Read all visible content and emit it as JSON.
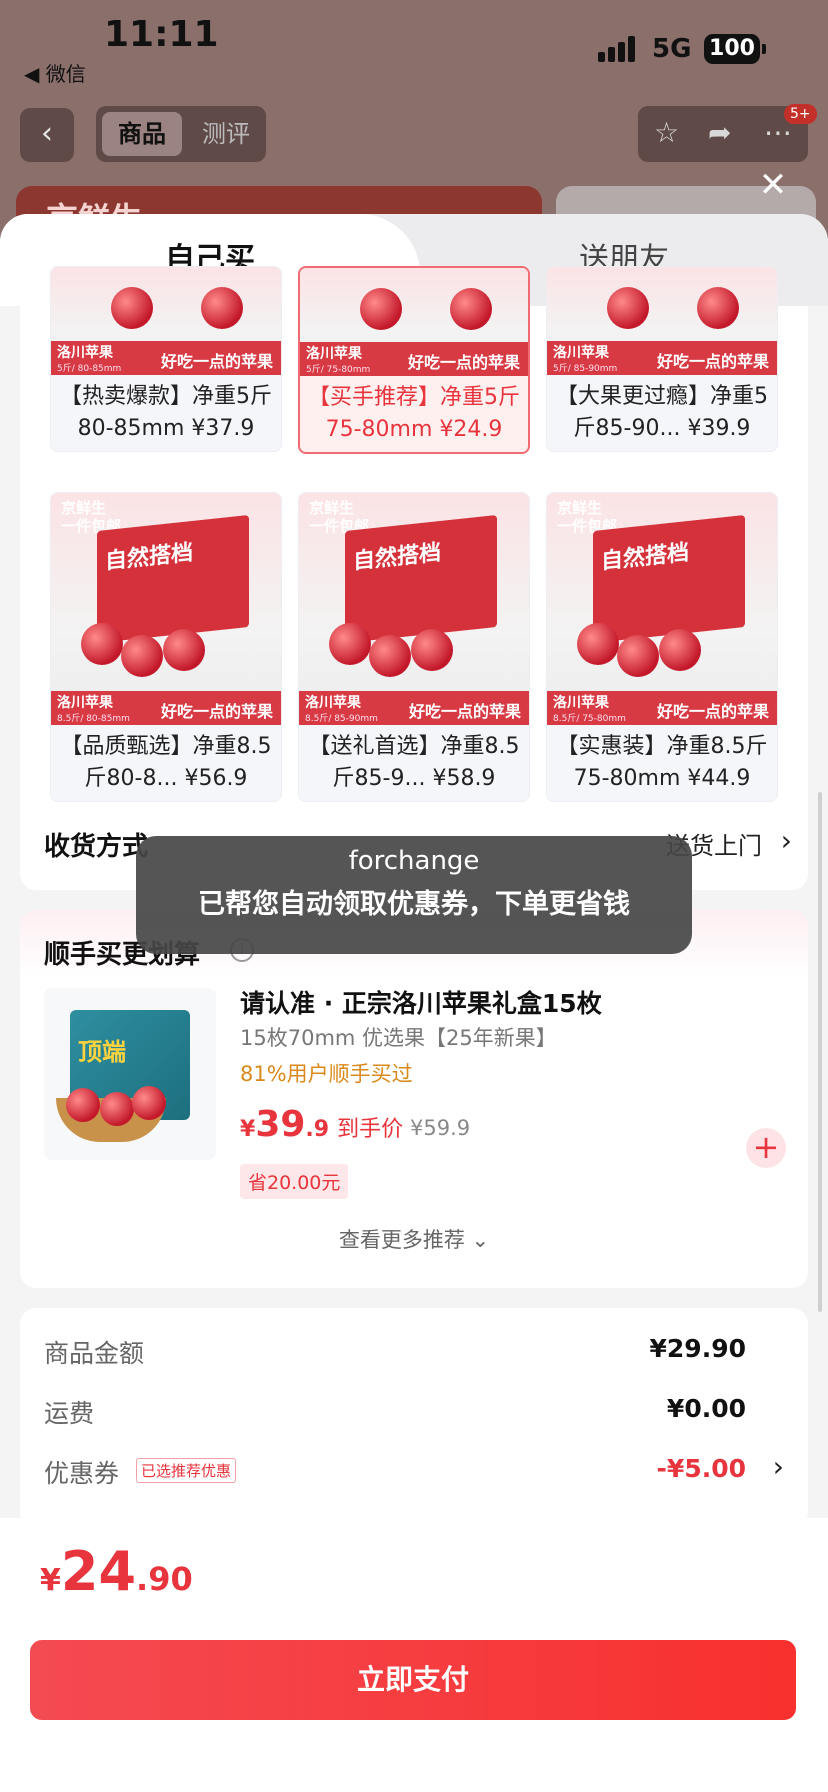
{
  "status_bar": {
    "time": "11:11",
    "back_app": "◀ 微信",
    "network": "5G",
    "battery": "100"
  },
  "nav": {
    "tab_goods": "商品",
    "tab_reviews": "测评",
    "cart_badge": "5+",
    "banner_text": "京鲜生"
  },
  "sheet": {
    "close_icon": "close-icon",
    "tabs": [
      {
        "label": "自己买"
      },
      {
        "label": "送朋友"
      }
    ]
  },
  "products": [
    {
      "brand": "",
      "bar_left": "洛川苹果",
      "bar_spec": "5斤/ 80-85mm",
      "bar_right": "好吃一点的苹果",
      "name": "【热卖爆款】净重5斤80-85mm ¥37.9",
      "selected": false
    },
    {
      "brand": "",
      "bar_left": "洛川苹果",
      "bar_spec": "5斤/ 75-80mm",
      "bar_right": "好吃一点的苹果",
      "name": "【买手推荐】净重5斤75-80mm ¥24.9",
      "selected": true
    },
    {
      "brand": "",
      "bar_left": "洛川苹果",
      "bar_spec": "5斤/ 85-90mm",
      "bar_right": "好吃一点的苹果",
      "name": "【大果更过瘾】净重5斤85-90... ¥39.9",
      "selected": false
    },
    {
      "brand": "京鲜生 一件包邮",
      "box_text": "自然搭档",
      "bar_left": "洛川苹果",
      "bar_spec": "8.5斤/ 80-85mm",
      "bar_right": "好吃一点的苹果",
      "name": "【品质甄选】净重8.5斤80-8... ¥56.9",
      "selected": false
    },
    {
      "brand": "京鲜生 一件包邮",
      "box_text": "自然搭档",
      "bar_left": "洛川苹果",
      "bar_spec": "8.5斤/ 85-90mm",
      "bar_right": "好吃一点的苹果",
      "name": "【送礼首选】净重8.5斤85-9... ¥58.9",
      "selected": false
    },
    {
      "brand": "京鲜生 一件包邮",
      "box_text": "自然搭档",
      "bar_left": "洛川苹果",
      "bar_spec": "8.5斤/ 75-80mm",
      "bar_right": "好吃一点的苹果",
      "name": "【实惠装】净重8.5斤75-80mm ¥44.9",
      "selected": false
    }
  ],
  "shipping": {
    "label": "收货方式",
    "value": "送货上门"
  },
  "toast": {
    "line1": "forchange",
    "line2": "已帮您自动领取优惠券，下单更省钱"
  },
  "recommend": {
    "title": "顺手买更划算",
    "product": {
      "name": "请认准 · 正宗洛川苹果礼盒15枚",
      "spec": "15枚70mm 优选果【25年新果】",
      "bought": "81%用户顺手买过",
      "price_currency": "¥",
      "price_int": "39",
      "price_dec": ".9",
      "price_tag": "到手价",
      "orig_price": "¥59.9",
      "save": "省20.00元",
      "box_text": "顶端"
    },
    "more": "查看更多推荐"
  },
  "summary": {
    "rows": [
      {
        "key": "商品金额",
        "value": "¥29.90"
      },
      {
        "key": "运费",
        "value": "¥0.00"
      },
      {
        "key": "优惠券",
        "tag": "已选推荐优惠",
        "value": "-¥5.00"
      }
    ]
  },
  "footer": {
    "currency": "¥",
    "total_int": "24",
    "total_dec": ".90",
    "pay_label": "立即支付"
  },
  "colors": {
    "accent": "#e8343d",
    "pay_button": "#f8302e"
  }
}
